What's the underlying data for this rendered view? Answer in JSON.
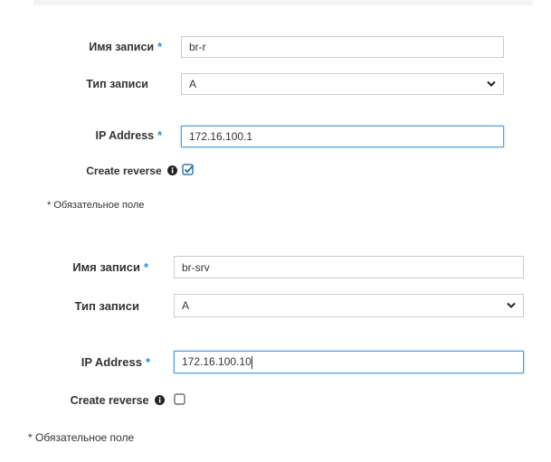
{
  "form1": {
    "name_label": "Имя записи",
    "name_value": "br-r",
    "type_label": "Тип записи",
    "type_value": "A",
    "ip_label": "IP Address",
    "ip_value": "172.16.100.1",
    "reverse_label": "Create reverse",
    "reverse_checked": true,
    "required_note": "* Обязательное поле"
  },
  "form2": {
    "name_label": "Имя записи",
    "name_value": "br-srv",
    "type_label": "Тип записи",
    "type_value": "A",
    "ip_label": "IP Address",
    "ip_value": "172.16.100.10",
    "reverse_label": "Create reverse",
    "reverse_checked": false,
    "required_note": "* Обязательное поле"
  },
  "required_marker": "*",
  "colors": {
    "required": "#1f8dd6",
    "focus_border": "#5b9dd9",
    "checkbox": "#337ab7"
  }
}
